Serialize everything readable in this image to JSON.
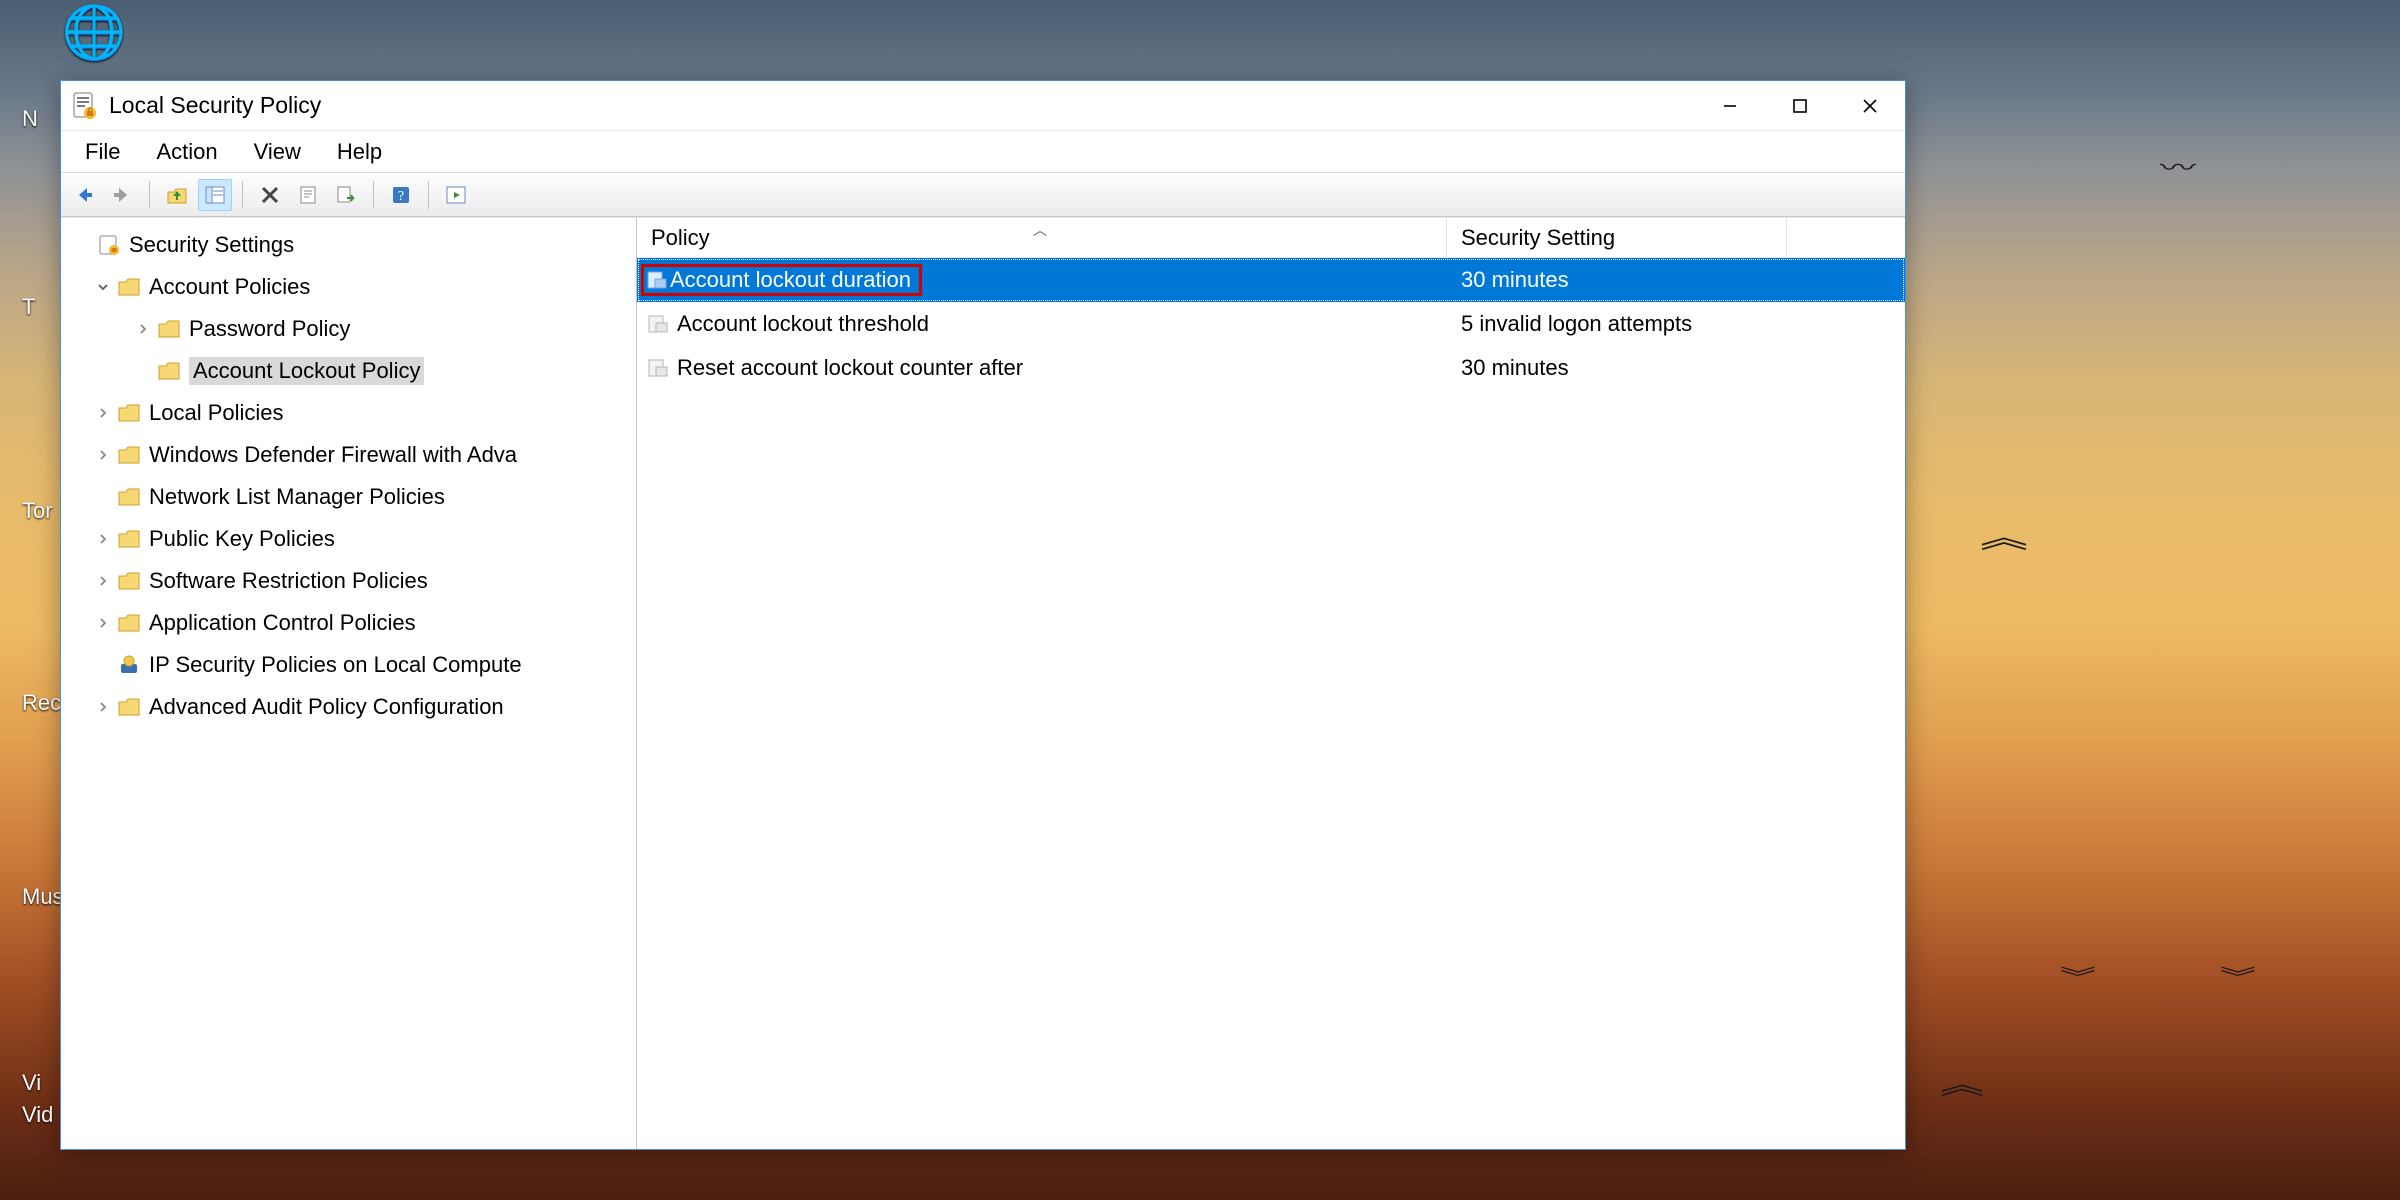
{
  "window": {
    "title": "Local Security Policy"
  },
  "menus": {
    "file": "File",
    "action": "Action",
    "view": "View",
    "help": "Help"
  },
  "tree": {
    "root": "Security Settings",
    "items": [
      {
        "label": "Account Policies",
        "expanded": true,
        "children": [
          {
            "label": "Password Policy"
          },
          {
            "label": "Account Lockout Policy",
            "selected": true
          }
        ]
      },
      {
        "label": "Local Policies"
      },
      {
        "label": "Windows Defender Firewall with Adva"
      },
      {
        "label": "Network List Manager Policies"
      },
      {
        "label": "Public Key Policies"
      },
      {
        "label": "Software Restriction Policies"
      },
      {
        "label": "Application Control Policies"
      },
      {
        "label": "IP Security Policies on Local Compute",
        "icon": "ipsec"
      },
      {
        "label": "Advanced Audit Policy Configuration"
      }
    ]
  },
  "list": {
    "columns": {
      "policy": "Policy",
      "setting": "Security Setting"
    },
    "rows": [
      {
        "policy": "Account lockout duration",
        "setting": "30 minutes",
        "selected": true,
        "highlighted": true
      },
      {
        "policy": "Account lockout threshold",
        "setting": "5 invalid logon attempts"
      },
      {
        "policy": "Reset account lockout counter after",
        "setting": "30 minutes"
      }
    ]
  },
  "desktop_labels": [
    "N",
    "T",
    "Tor",
    "Rec",
    "Mus",
    "Vi",
    "Vid"
  ]
}
